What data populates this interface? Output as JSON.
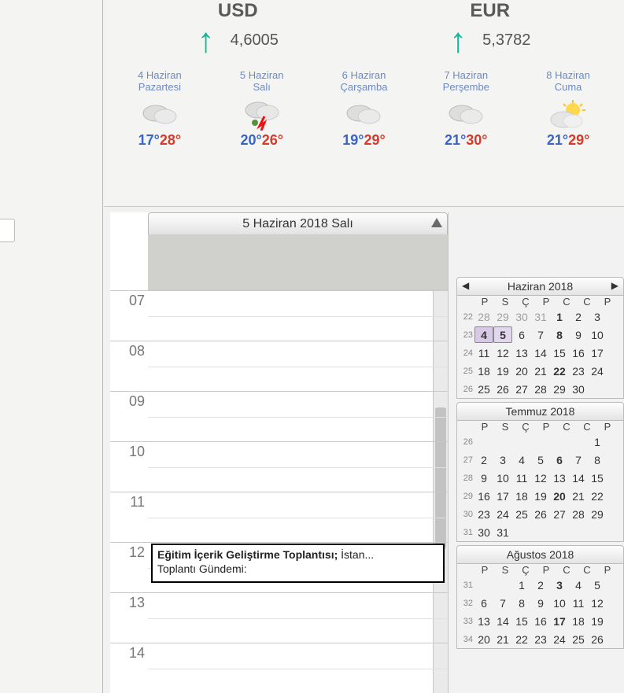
{
  "currencies": [
    {
      "code": "USD",
      "rate": "4,6005"
    },
    {
      "code": "EUR",
      "rate": "5,3782"
    }
  ],
  "weather": [
    {
      "date": "4 Haziran",
      "day": "Pazartesi",
      "icon": "cloud",
      "lo": "17°",
      "hi": "28°"
    },
    {
      "date": "5 Haziran",
      "day": "Salı",
      "icon": "storm",
      "lo": "20°",
      "hi": "26°"
    },
    {
      "date": "6 Haziran",
      "day": "Çarşamba",
      "icon": "cloud",
      "lo": "19°",
      "hi": "29°"
    },
    {
      "date": "7 Haziran",
      "day": "Perşembe",
      "icon": "cloud",
      "lo": "21°",
      "hi": "30°"
    },
    {
      "date": "8 Haziran",
      "day": "Cuma",
      "icon": "partly-sunny",
      "lo": "21°",
      "hi": "29°"
    }
  ],
  "schedule": {
    "date_title": "5 Haziran 2018 Salı",
    "hours": [
      "07",
      "08",
      "09",
      "10",
      "11",
      "12",
      "13",
      "14"
    ],
    "event": {
      "title": "Eğitim İçerik Geliştirme Toplantısı;",
      "location": " İstan...",
      "line2": "Toplantı Gündemi:"
    }
  },
  "mini_months": [
    {
      "title": "Haziran 2018",
      "show_arrows": true,
      "dow": [
        "P",
        "S",
        "Ç",
        "P",
        "C",
        "C",
        "P"
      ],
      "weeks": [
        {
          "n": "22",
          "d": [
            {
              "t": "28",
              "out": true
            },
            {
              "t": "29",
              "out": true
            },
            {
              "t": "30",
              "out": true
            },
            {
              "t": "31",
              "out": true
            },
            {
              "t": "1",
              "bold": true
            },
            {
              "t": "2"
            },
            {
              "t": "3"
            }
          ]
        },
        {
          "n": "23",
          "d": [
            {
              "t": "4",
              "today": true,
              "bold": true
            },
            {
              "t": "5",
              "sel": true,
              "bold": true
            },
            {
              "t": "6"
            },
            {
              "t": "7"
            },
            {
              "t": "8",
              "bold": true
            },
            {
              "t": "9"
            },
            {
              "t": "10"
            }
          ]
        },
        {
          "n": "24",
          "d": [
            {
              "t": "11"
            },
            {
              "t": "12"
            },
            {
              "t": "13"
            },
            {
              "t": "14"
            },
            {
              "t": "15"
            },
            {
              "t": "16"
            },
            {
              "t": "17"
            }
          ]
        },
        {
          "n": "25",
          "d": [
            {
              "t": "18"
            },
            {
              "t": "19"
            },
            {
              "t": "20"
            },
            {
              "t": "21"
            },
            {
              "t": "22",
              "bold": true
            },
            {
              "t": "23"
            },
            {
              "t": "24"
            }
          ]
        },
        {
          "n": "26",
          "d": [
            {
              "t": "25"
            },
            {
              "t": "26"
            },
            {
              "t": "27"
            },
            {
              "t": "28"
            },
            {
              "t": "29"
            },
            {
              "t": "30"
            },
            {
              "t": ""
            }
          ]
        }
      ]
    },
    {
      "title": "Temmuz 2018",
      "show_arrows": false,
      "dow": [
        "P",
        "S",
        "Ç",
        "P",
        "C",
        "C",
        "P"
      ],
      "weeks": [
        {
          "n": "26",
          "d": [
            {
              "t": ""
            },
            {
              "t": ""
            },
            {
              "t": ""
            },
            {
              "t": ""
            },
            {
              "t": ""
            },
            {
              "t": ""
            },
            {
              "t": "1"
            }
          ]
        },
        {
          "n": "27",
          "d": [
            {
              "t": "2"
            },
            {
              "t": "3"
            },
            {
              "t": "4"
            },
            {
              "t": "5"
            },
            {
              "t": "6",
              "bold": true
            },
            {
              "t": "7"
            },
            {
              "t": "8"
            }
          ]
        },
        {
          "n": "28",
          "d": [
            {
              "t": "9"
            },
            {
              "t": "10"
            },
            {
              "t": "11"
            },
            {
              "t": "12"
            },
            {
              "t": "13"
            },
            {
              "t": "14"
            },
            {
              "t": "15"
            }
          ]
        },
        {
          "n": "29",
          "d": [
            {
              "t": "16"
            },
            {
              "t": "17"
            },
            {
              "t": "18"
            },
            {
              "t": "19"
            },
            {
              "t": "20",
              "bold": true
            },
            {
              "t": "21"
            },
            {
              "t": "22"
            }
          ]
        },
        {
          "n": "30",
          "d": [
            {
              "t": "23"
            },
            {
              "t": "24"
            },
            {
              "t": "25"
            },
            {
              "t": "26"
            },
            {
              "t": "27"
            },
            {
              "t": "28"
            },
            {
              "t": "29"
            }
          ]
        },
        {
          "n": "31",
          "d": [
            {
              "t": "30"
            },
            {
              "t": "31"
            },
            {
              "t": ""
            },
            {
              "t": ""
            },
            {
              "t": ""
            },
            {
              "t": ""
            },
            {
              "t": ""
            }
          ]
        }
      ]
    },
    {
      "title": "Ağustos 2018",
      "show_arrows": false,
      "dow": [
        "P",
        "S",
        "Ç",
        "P",
        "C",
        "C",
        "P"
      ],
      "weeks": [
        {
          "n": "31",
          "d": [
            {
              "t": ""
            },
            {
              "t": ""
            },
            {
              "t": "1"
            },
            {
              "t": "2"
            },
            {
              "t": "3",
              "bold": true
            },
            {
              "t": "4"
            },
            {
              "t": "5"
            }
          ]
        },
        {
          "n": "32",
          "d": [
            {
              "t": "6"
            },
            {
              "t": "7"
            },
            {
              "t": "8"
            },
            {
              "t": "9"
            },
            {
              "t": "10"
            },
            {
              "t": "11"
            },
            {
              "t": "12"
            }
          ]
        },
        {
          "n": "33",
          "d": [
            {
              "t": "13"
            },
            {
              "t": "14"
            },
            {
              "t": "15"
            },
            {
              "t": "16"
            },
            {
              "t": "17",
              "bold": true
            },
            {
              "t": "18"
            },
            {
              "t": "19"
            }
          ]
        },
        {
          "n": "34",
          "d": [
            {
              "t": "20"
            },
            {
              "t": "21"
            },
            {
              "t": "22"
            },
            {
              "t": "23"
            },
            {
              "t": "24"
            },
            {
              "t": "25"
            },
            {
              "t": "26"
            }
          ]
        }
      ]
    }
  ]
}
